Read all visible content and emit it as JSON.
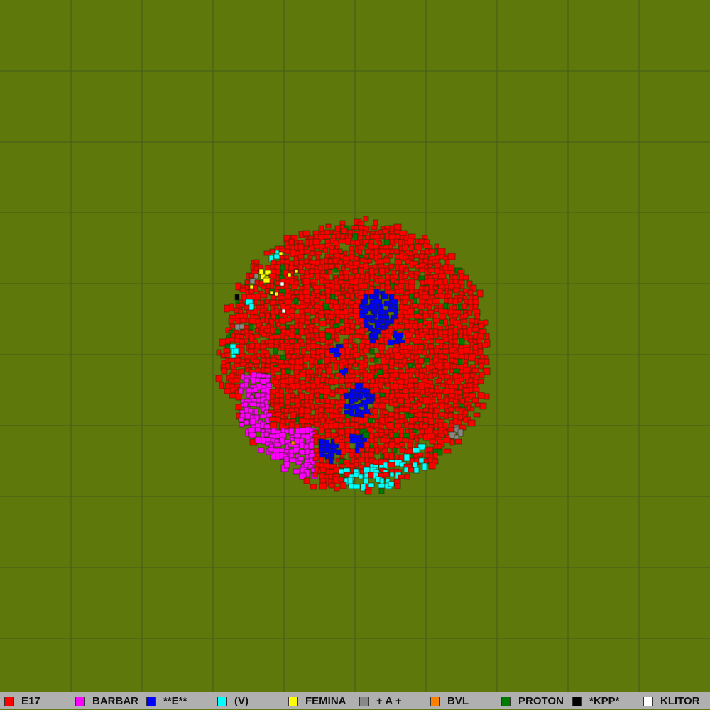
{
  "colors": {
    "background": "#5f780c",
    "grid": "#3f5c18",
    "legend_bg": "#b0b0b0"
  },
  "teams": [
    {
      "label": "E17",
      "color": "#ff0000",
      "icon": "red-swatch"
    },
    {
      "label": "BARBAR",
      "color": "#ff00ff",
      "icon": "magenta-swatch"
    },
    {
      "label": "**E**",
      "color": "#0000ff",
      "icon": "blue-swatch"
    },
    {
      "label": "(V)",
      "color": "#00ffff",
      "icon": "cyan-swatch"
    },
    {
      "label": "FEMINA",
      "color": "#ffff00",
      "icon": "yellow-swatch"
    },
    {
      "label": "+ A +",
      "color": "#888888",
      "icon": "gray-swatch"
    },
    {
      "label": "BVL",
      "color": "#ff8000",
      "icon": "orange-swatch"
    },
    {
      "label": "PROTON",
      "color": "#007a00",
      "icon": "green-swatch"
    },
    {
      "label": "*KPP*",
      "color": "#000000",
      "icon": "black-swatch"
    },
    {
      "label": "KLITOR",
      "color": "#ffffff",
      "icon": "white-swatch"
    }
  ]
}
